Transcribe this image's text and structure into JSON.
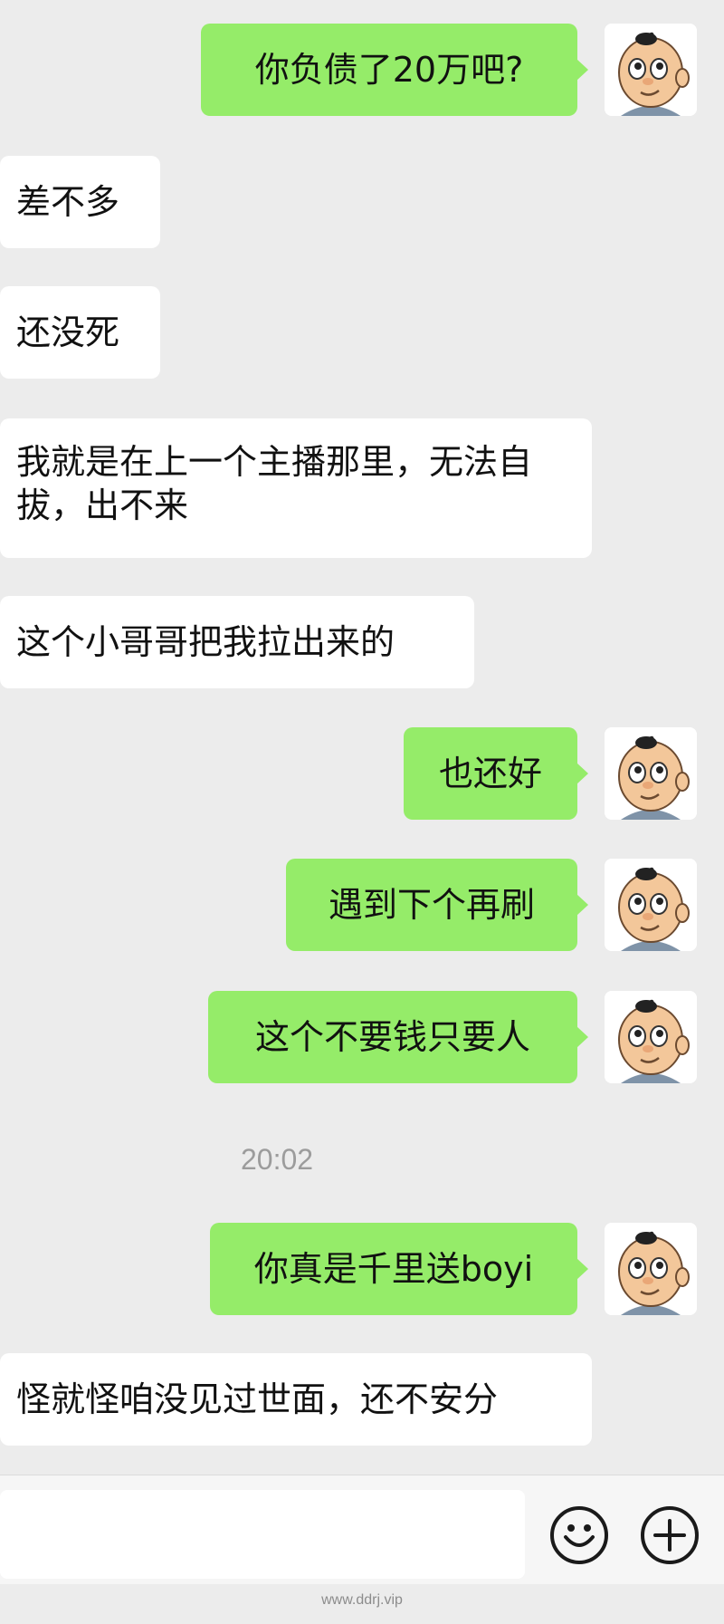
{
  "messages": [
    {
      "text": "你负债了20万吧?"
    },
    {
      "text": "差不多"
    },
    {
      "text": "还没死"
    },
    {
      "text": "我就是在上一个主播那里，无法自拔，出不来"
    },
    {
      "text": "这个小哥哥把我拉出来的"
    },
    {
      "text": "也还好"
    },
    {
      "text": "遇到下个再刷"
    },
    {
      "text": "这个不要钱只要人"
    },
    {
      "text": "你真是千里送boyi"
    },
    {
      "text": "怪就怪咱没见过世面，还不安分"
    }
  ],
  "timestamp": "20:02",
  "watermark": "www.ddrj.vip",
  "input_bar": {
    "left_icon": "emoji-icon",
    "right_icon": "plus-icon"
  },
  "colors": {
    "outgoing_bubble": "#95ec69",
    "incoming_bubble": "#ffffff",
    "background": "#ececec"
  }
}
